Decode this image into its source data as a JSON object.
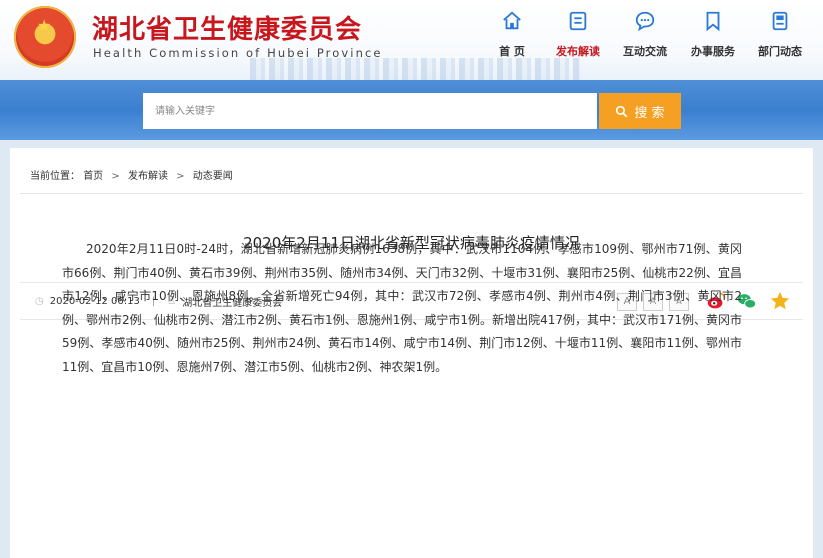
{
  "site": {
    "title": "湖北省卫生健康委员会",
    "subtitle": "Health Commission of Hubei Province"
  },
  "nav": {
    "items": [
      {
        "label": "首 页",
        "icon": "home-icon"
      },
      {
        "label": "发布解读",
        "icon": "document-icon"
      },
      {
        "label": "互动交流",
        "icon": "chat-icon"
      },
      {
        "label": "办事服务",
        "icon": "bookmark-icon"
      },
      {
        "label": "部门动态",
        "icon": "news-icon"
      }
    ],
    "active_index": 1
  },
  "search": {
    "placeholder": "请输入关键字",
    "button_label": "搜 索"
  },
  "breadcrumb": {
    "prefix": "当前位置：",
    "items": [
      "首页",
      "发布解读",
      "动态要闻"
    ]
  },
  "article": {
    "title": "2020年2月11日湖北省新型冠状病毒肺炎疫情情况",
    "date": "2020-02-12 06:13",
    "source": "湖北省卫生健康委员会",
    "font_sizes": [
      "A",
      "A",
      "A"
    ],
    "body": "2020年2月11日0时-24时，湖北省新增新冠肺炎病例1638例，其中：武汉市1104例、孝感市109例、鄂州市71例、黄冈市66例、荆门市40例、黄石市39例、荆州市35例、随州市34例、天门市32例、十堰市31例、襄阳市25例、仙桃市22例、宜昌市12例、咸宁市10例、恩施州8例。全省新增死亡94例，其中：武汉市72例、孝感市4例、荆州市4例、荆门市3例、黄冈市2例、鄂州市2例、仙桃市2例、潜江市2例、黄石市1例、恩施州1例、咸宁市1例。新增出院417例，其中：武汉市171例、黄冈市59例、孝感市40例、随州市25例、荆州市24例、黄石市14例、咸宁市14例、荆门市12例、十堰市11例、襄阳市11例、鄂州市11例、宜昌市10例、恩施州7例、潜江市5例、仙桃市2例、神农架1例。"
  },
  "colors": {
    "brand_red": "#c8161d",
    "nav_icon_blue": "#2b7ad6",
    "search_orange": "#f5a022",
    "band_blue": "#3b7fd0"
  }
}
